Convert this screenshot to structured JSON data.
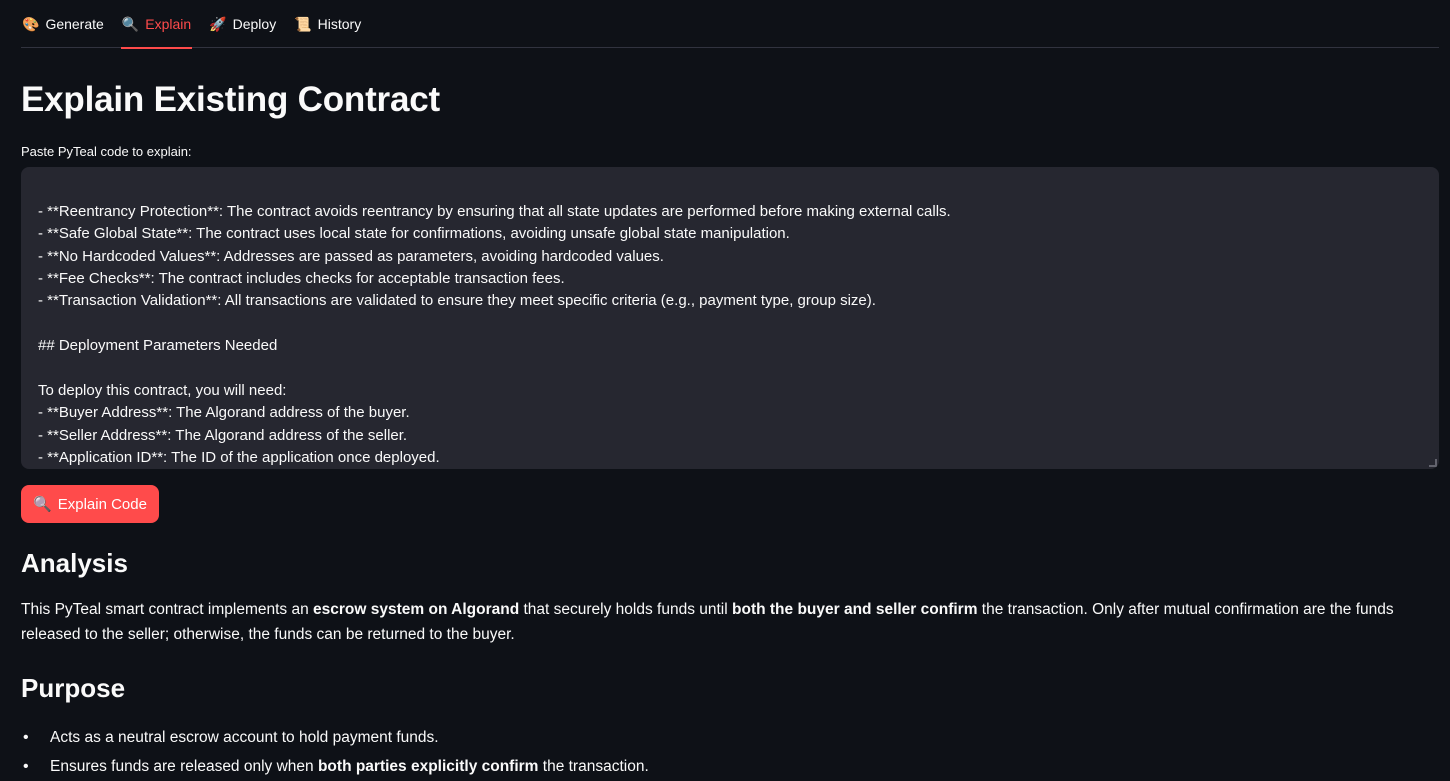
{
  "tabs": [
    {
      "icon": "🎨",
      "icon_name": "palette-icon",
      "label": "Generate"
    },
    {
      "icon": "🔍",
      "icon_name": "magnifier-icon",
      "label": "Explain"
    },
    {
      "icon": "🚀",
      "icon_name": "rocket-icon",
      "label": "Deploy"
    },
    {
      "icon": "📜",
      "icon_name": "scroll-icon",
      "label": "History"
    }
  ],
  "active_tab": "Explain",
  "accent_color": "#ff4b4b",
  "page_title": "Explain Existing Contract",
  "code_input": {
    "label": "Paste PyTeal code to explain:",
    "value": "- **Reentrancy Protection**: The contract avoids reentrancy by ensuring that all state updates are performed before making external calls.\n- **Safe Global State**: The contract uses local state for confirmations, avoiding unsafe global state manipulation.\n- **No Hardcoded Values**: Addresses are passed as parameters, avoiding hardcoded values.\n- **Fee Checks**: The contract includes checks for acceptable transaction fees.\n- **Transaction Validation**: All transactions are validated to ensure they meet specific criteria (e.g., payment type, group size).\n\n## Deployment Parameters Needed\n\nTo deploy this contract, you will need:\n- **Buyer Address**: The Algorand address of the buyer.\n- **Seller Address**: The Algorand address of the seller.\n- **Application ID**: The ID of the application once deployed.\n- **Network**: The Algorand network (e.g., MainNet, TestNet) where the contract will be deployed.\n- **Transaction Parameters**: Suggested transaction parameters (e.g., fee, first valid round) for initializing and interacting with the contract."
  },
  "explain_button": {
    "icon": "🔍",
    "label": "Explain Code"
  },
  "analysis": {
    "heading": "Analysis",
    "parts": [
      "This PyTeal smart contract implements an ",
      "escrow system on Algorand",
      " that securely holds funds until ",
      "both the buyer and seller confirm",
      " the transaction. Only after mutual confirmation are the funds released to the seller; otherwise, the funds can be returned to the buyer."
    ]
  },
  "purpose": {
    "heading": "Purpose",
    "items": [
      {
        "text": "Acts as a neutral escrow account to hold payment funds."
      },
      {
        "pre": "Ensures funds are released only when ",
        "bold": "both parties explicitly confirm",
        "post": " the transaction."
      }
    ]
  }
}
